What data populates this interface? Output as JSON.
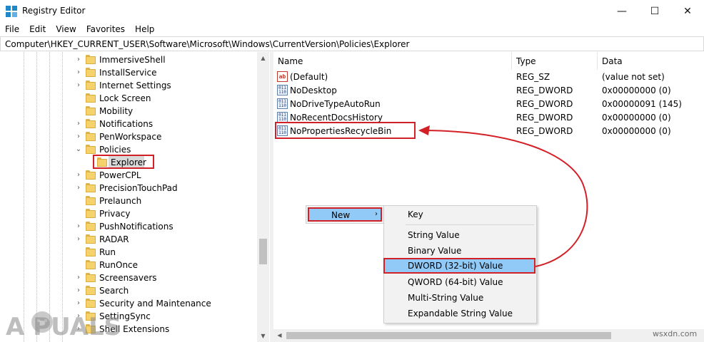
{
  "window": {
    "title": "Registry Editor",
    "minimize_glyph": "—",
    "maximize_glyph": "☐",
    "close_glyph": "✕"
  },
  "menu": [
    "File",
    "Edit",
    "View",
    "Favorites",
    "Help"
  ],
  "address": "Computer\\HKEY_CURRENT_USER\\Software\\Microsoft\\Windows\\CurrentVersion\\Policies\\Explorer",
  "tree": {
    "items": [
      {
        "label": "ImmersiveShell",
        "expand": "collapsed"
      },
      {
        "label": "InstallService",
        "expand": "collapsed"
      },
      {
        "label": "Internet Settings",
        "expand": "collapsed"
      },
      {
        "label": "Lock Screen",
        "expand": "none"
      },
      {
        "label": "Mobility",
        "expand": "none"
      },
      {
        "label": "Notifications",
        "expand": "collapsed"
      },
      {
        "label": "PenWorkspace",
        "expand": "collapsed"
      },
      {
        "label": "Policies",
        "expand": "expanded"
      },
      {
        "label": "Explorer",
        "expand": "none",
        "child": true,
        "selected": true
      },
      {
        "label": "PowerCPL",
        "expand": "collapsed"
      },
      {
        "label": "PrecisionTouchPad",
        "expand": "collapsed"
      },
      {
        "label": "Prelaunch",
        "expand": "none"
      },
      {
        "label": "Privacy",
        "expand": "none"
      },
      {
        "label": "PushNotifications",
        "expand": "collapsed"
      },
      {
        "label": "RADAR",
        "expand": "collapsed"
      },
      {
        "label": "Run",
        "expand": "none"
      },
      {
        "label": "RunOnce",
        "expand": "none"
      },
      {
        "label": "Screensavers",
        "expand": "collapsed"
      },
      {
        "label": "Search",
        "expand": "collapsed"
      },
      {
        "label": "Security and Maintenance",
        "expand": "collapsed"
      },
      {
        "label": "SettingSync",
        "expand": "collapsed"
      },
      {
        "label": "Shell Extensions",
        "expand": "collapsed"
      }
    ]
  },
  "values": {
    "columns": {
      "name": "Name",
      "type": "Type",
      "data": "Data"
    },
    "rows": [
      {
        "name": "(Default)",
        "type": "REG_SZ",
        "data": "(value not set)",
        "icon": "string-value-icon"
      },
      {
        "name": "NoDesktop",
        "type": "REG_DWORD",
        "data": "0x00000000 (0)",
        "icon": "binary-value-icon"
      },
      {
        "name": "NoDriveTypeAutoRun",
        "type": "REG_DWORD",
        "data": "0x00000091 (145)",
        "icon": "binary-value-icon"
      },
      {
        "name": "NoRecentDocsHistory",
        "type": "REG_DWORD",
        "data": "0x00000000 (0)",
        "icon": "binary-value-icon"
      },
      {
        "name": "NoPropertiesRecycleBin",
        "type": "REG_DWORD",
        "data": "0x00000000 (0)",
        "icon": "binary-value-icon"
      }
    ]
  },
  "context_menu": {
    "new_label": "New",
    "new_arrow": "›",
    "submenu": [
      "Key",
      "String Value",
      "Binary Value",
      "DWORD (32-bit) Value",
      "QWORD (64-bit) Value",
      "Multi-String Value",
      "Expandable String Value"
    ],
    "highlighted": "DWORD (32-bit) Value"
  },
  "watermarks": {
    "brand": "A  PUALS",
    "site": "wsxdn.com"
  },
  "colors": {
    "annotation_red": "#d32027",
    "menu_highlight": "#91c9f7",
    "folder_yellow": "#f5d26b"
  }
}
